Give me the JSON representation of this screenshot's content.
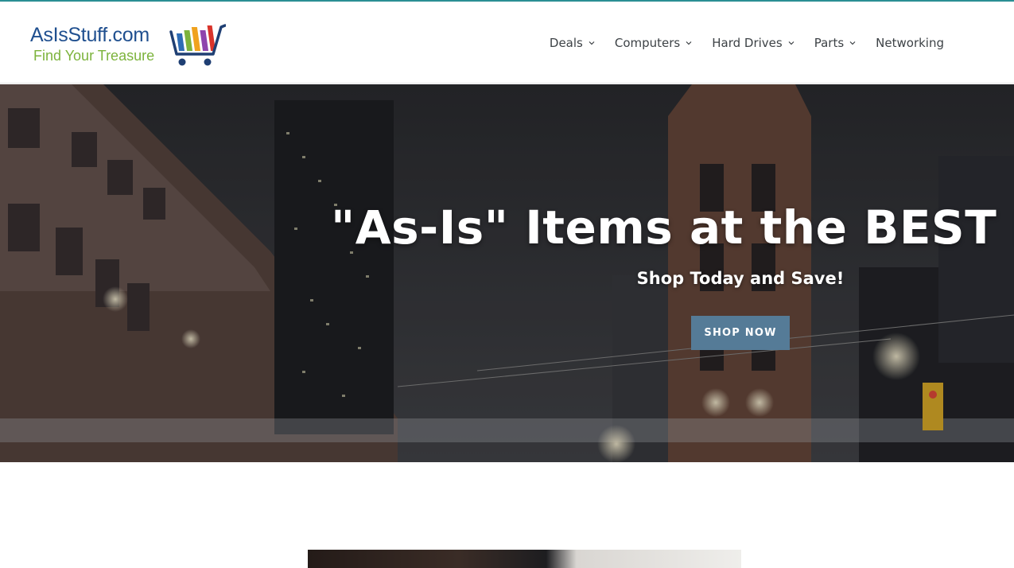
{
  "logo": {
    "line1": "AsIsStuff.com",
    "line2": "Find Your Treasure",
    "icon": "shopping-cart-icon",
    "colors": {
      "primary": "#1f4f8f",
      "tagline": "#7cb33c"
    }
  },
  "nav": {
    "items": [
      {
        "label": "Deals",
        "has_dropdown": true
      },
      {
        "label": "Computers",
        "has_dropdown": true
      },
      {
        "label": "Hard Drives",
        "has_dropdown": true
      },
      {
        "label": "Parts",
        "has_dropdown": true
      },
      {
        "label": "Networking",
        "has_dropdown": false
      }
    ]
  },
  "hero": {
    "title": "\"As-Is\" Items at the BEST Prices",
    "subtitle": "Shop Today and Save!",
    "button_label": "SHOP NOW",
    "button_color": "#557b97"
  },
  "colors": {
    "accent_rule": "#2a8f94",
    "nav_text": "#3d4246"
  }
}
